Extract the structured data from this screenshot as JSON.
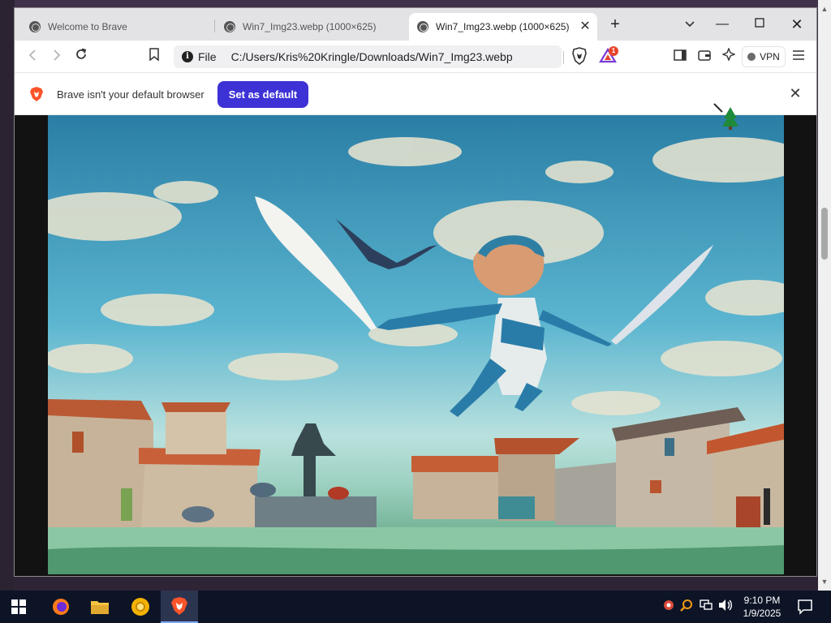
{
  "tabs": [
    {
      "title": "Welcome to Brave",
      "active": false
    },
    {
      "title": "Win7_Img23.webp (1000×625)",
      "active": false
    },
    {
      "title": "Win7_Img23.webp (1000×625)",
      "active": true
    }
  ],
  "toolbar": {
    "scheme_label": "File",
    "url": "C:/Users/Kris%20Kringle/Downloads/Win7_Img23.webp",
    "rewards_badge": "1",
    "vpn_label": "VPN"
  },
  "infobar": {
    "message": "Brave isn't your default browser",
    "button_label": "Set as default"
  },
  "taskbar": {
    "time": "9:10 PM",
    "date": "1/9/2025"
  },
  "colors": {
    "brand_button": "#3d32d6",
    "brave_orange": "#fb542b"
  }
}
